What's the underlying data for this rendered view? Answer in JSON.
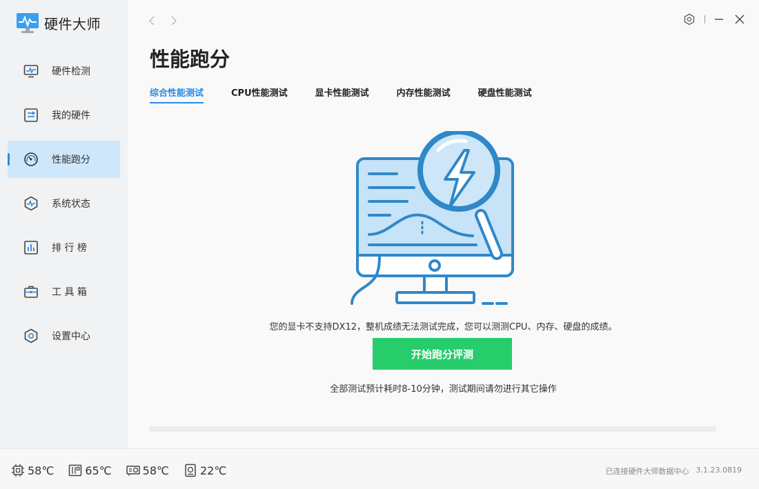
{
  "app": {
    "name": "硬件大师"
  },
  "sidebar": {
    "items": [
      {
        "label": "硬件检测",
        "icon": "monitor-pulse-icon",
        "active": false
      },
      {
        "label": "我的硬件",
        "icon": "hardware-list-icon",
        "active": false
      },
      {
        "label": "性能跑分",
        "icon": "speedometer-icon",
        "active": true
      },
      {
        "label": "系统状态",
        "icon": "pulse-hexagon-icon",
        "active": false
      },
      {
        "label": "排 行 榜",
        "icon": "bar-chart-icon",
        "active": false
      },
      {
        "label": "工 具 箱",
        "icon": "toolbox-icon",
        "active": false
      },
      {
        "label": "设置中心",
        "icon": "hexagon-settings-icon",
        "active": false
      }
    ]
  },
  "page": {
    "title": "性能跑分",
    "tabs": [
      {
        "label": "综合性能测试",
        "active": true
      },
      {
        "label": "CPU性能测试",
        "active": false
      },
      {
        "label": "显卡性能测试",
        "active": false
      },
      {
        "label": "内存性能测试",
        "active": false
      },
      {
        "label": "硬盘性能测试",
        "active": false
      }
    ],
    "notice": "您的显卡不支持DX12，整机成绩无法测试完成，您可以测测CPU、内存、硬盘的成绩。",
    "start_button": "开始跑分评测",
    "hint": "全部测试预计耗时8-10分钟，测试期间请勿进行其它操作",
    "progress": 0
  },
  "status": {
    "temps": [
      {
        "icon": "cpu-chip-icon",
        "value": "58℃"
      },
      {
        "icon": "motherboard-icon",
        "value": "65℃"
      },
      {
        "icon": "gpu-card-icon",
        "value": "58℃"
      },
      {
        "icon": "hard-disk-icon",
        "value": "22℃"
      }
    ],
    "connection": "已连接硬件大师数据中心",
    "version": "3.1.23.0819"
  },
  "colors": {
    "accent": "#2a8ae0",
    "start_button": "#27cc6b",
    "sidebar_active": "#cfe7fa"
  }
}
